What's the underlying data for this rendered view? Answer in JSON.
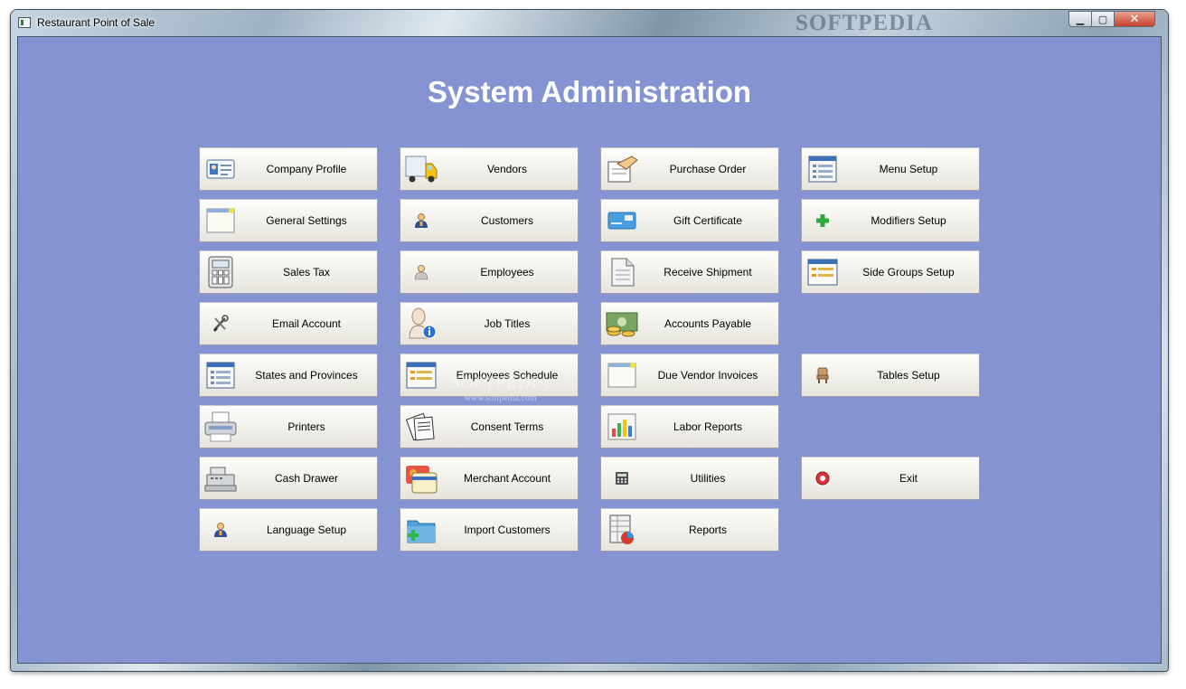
{
  "window": {
    "title": "Restaurant Point of Sale",
    "watermark": "SOFTPEDIA",
    "controls": {
      "minimize": "▁",
      "maximize": "▢",
      "close": "✕"
    }
  },
  "page": {
    "title": "System Administration"
  },
  "watermark": {
    "text": "SOFTPEDIA",
    "url": "www.softpedia.com"
  },
  "colors": {
    "background": "#8693d2",
    "title_text": "#ffffff",
    "tile_top": "#fdfdfb",
    "tile_bottom": "#e6e4dc"
  },
  "menu": {
    "column1": [
      {
        "label": "Company Profile",
        "icon": "id-card-icon"
      },
      {
        "label": "General Settings",
        "icon": "window-icon"
      },
      {
        "label": "Sales Tax",
        "icon": "calculator-icon"
      },
      {
        "label": "Email Account",
        "icon": "tools-icon"
      },
      {
        "label": "States and Provinces",
        "icon": "list-icon"
      },
      {
        "label": "Printers",
        "icon": "printer-icon"
      },
      {
        "label": "Cash Drawer",
        "icon": "cash-register-icon"
      },
      {
        "label": "Language Setup",
        "icon": "user-icon"
      }
    ],
    "column2": [
      {
        "label": "Vendors",
        "icon": "truck-icon"
      },
      {
        "label": "Customers",
        "icon": "user-icon"
      },
      {
        "label": "Employees",
        "icon": "person-icon"
      },
      {
        "label": "Job Titles",
        "icon": "person-info-icon"
      },
      {
        "label": "Employees Schedule",
        "icon": "schedule-icon"
      },
      {
        "label": "Consent Terms",
        "icon": "documents-icon"
      },
      {
        "label": "Merchant Account",
        "icon": "cards-icon"
      },
      {
        "label": "Import Customers",
        "icon": "folder-add-icon"
      }
    ],
    "column3": [
      {
        "label": "Purchase Order",
        "icon": "order-icon"
      },
      {
        "label": "Gift Certificate",
        "icon": "gift-card-icon"
      },
      {
        "label": "Receive Shipment",
        "icon": "document-icon"
      },
      {
        "label": "Accounts Payable",
        "icon": "money-icon"
      },
      {
        "label": "Due Vendor Invoices",
        "icon": "window-icon"
      },
      {
        "label": "Labor Reports",
        "icon": "bar-chart-icon"
      },
      {
        "label": "Utilities",
        "icon": "calculator-small-icon"
      },
      {
        "label": "Reports",
        "icon": "report-icon"
      }
    ],
    "column4": [
      {
        "label": "Menu Setup",
        "icon": "menu-list-icon"
      },
      {
        "label": "Modifiers Setup",
        "icon": "plus-icon"
      },
      {
        "label": "Side Groups Setup",
        "icon": "schedule-icon"
      },
      {
        "label": "Tables Setup",
        "icon": "chair-icon"
      },
      {
        "label": "Exit",
        "icon": "exit-icon"
      }
    ]
  }
}
